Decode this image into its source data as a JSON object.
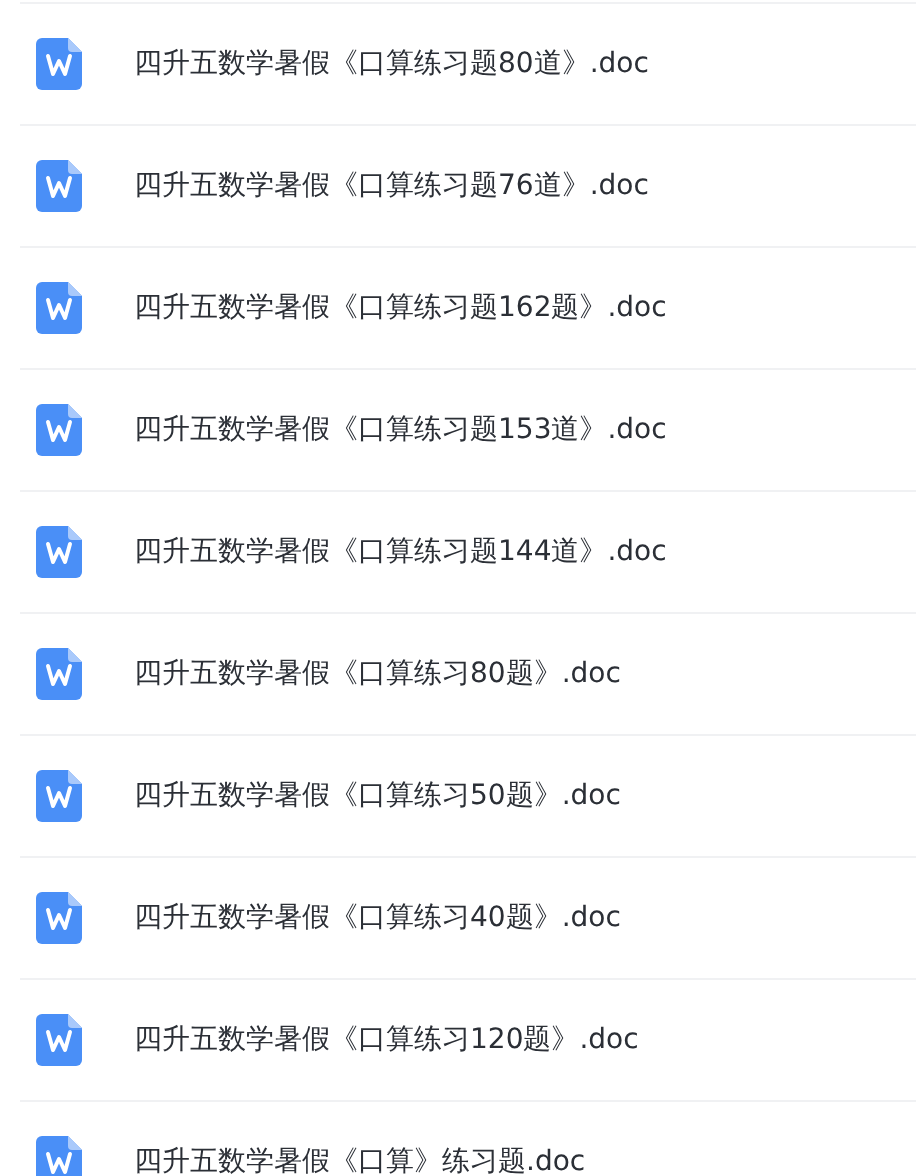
{
  "files": [
    {
      "name": "四升五数学暑假《口算练习题80道》.doc"
    },
    {
      "name": "四升五数学暑假《口算练习题76道》.doc"
    },
    {
      "name": "四升五数学暑假《口算练习题162题》.doc"
    },
    {
      "name": "四升五数学暑假《口算练习题153道》.doc"
    },
    {
      "name": "四升五数学暑假《口算练习题144道》.doc"
    },
    {
      "name": "四升五数学暑假《口算练习80题》.doc"
    },
    {
      "name": "四升五数学暑假《口算练习50题》.doc"
    },
    {
      "name": "四升五数学暑假《口算练习40题》.doc"
    },
    {
      "name": "四升五数学暑假《口算练习120题》.doc"
    },
    {
      "name": "四升五数学暑假《口算》练习题.doc"
    }
  ]
}
